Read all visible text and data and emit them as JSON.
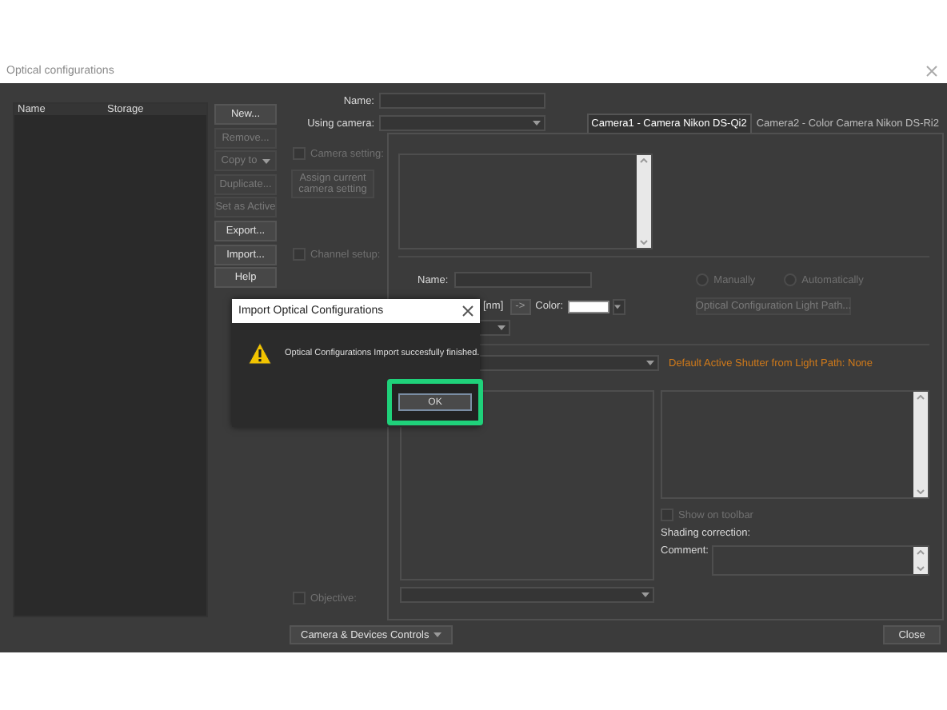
{
  "window": {
    "title": "Optical configurations"
  },
  "config_list": {
    "columns": [
      "Name",
      "Storage"
    ]
  },
  "side_buttons": [
    {
      "label": "New...",
      "kind": "button",
      "disabled": false
    },
    {
      "label": "Remove...",
      "kind": "button",
      "disabled": true
    },
    {
      "label": "Copy to",
      "kind": "dropdown",
      "disabled": true
    },
    {
      "label": "Duplicate...",
      "kind": "button",
      "disabled": true
    },
    {
      "label": "Set as Active",
      "kind": "button",
      "disabled": true
    },
    {
      "label": "Export...",
      "kind": "button",
      "disabled": false
    },
    {
      "label": "Import...",
      "kind": "button",
      "disabled": false
    },
    {
      "label": "Help",
      "kind": "button",
      "disabled": false
    }
  ],
  "form": {
    "name_label": "Name:",
    "camera_label": "Using camera:"
  },
  "camera_tabs": [
    {
      "label": "Camera1 - Camera Nikon DS-Qi2",
      "selected": true
    },
    {
      "label": "Camera2 - Color Camera Nikon DS-Ri2",
      "selected": false
    }
  ],
  "camera_setting": {
    "label": "Camera setting:",
    "checked": false,
    "disabled": true
  },
  "assign_button": {
    "label": "Assign current camera setting",
    "disabled": true
  },
  "channel_setup": {
    "label": "Channel setup:",
    "checked": false,
    "disabled": true
  },
  "channel": {
    "name_label": "Name:",
    "unit_label": "[nm]",
    "arrow_button": "->",
    "color_label": "Color:"
  },
  "mode_radios": [
    {
      "label": "Manually",
      "selected": false,
      "disabled": true
    },
    {
      "label": "Automatically",
      "selected": false,
      "disabled": true
    }
  ],
  "light_path_button": {
    "label": "Optical Configuration Light Path...",
    "disabled": true
  },
  "shutter_note": "Default Active Shutter from Light Path: None",
  "show_on_toolbar": {
    "label": "Show on toolbar",
    "checked": false,
    "disabled": true
  },
  "shading_label": "Shading correction:",
  "comment_label": "Comment:",
  "objective": {
    "label": "Objective:",
    "checked": false,
    "disabled": true
  },
  "footer": {
    "controls_button": "Camera & Devices Controls",
    "close_button": "Close"
  },
  "dialog": {
    "title": "Import Optical Configurations",
    "message": "Optical Configurations Import succesfully finished.",
    "ok_button": "OK"
  }
}
